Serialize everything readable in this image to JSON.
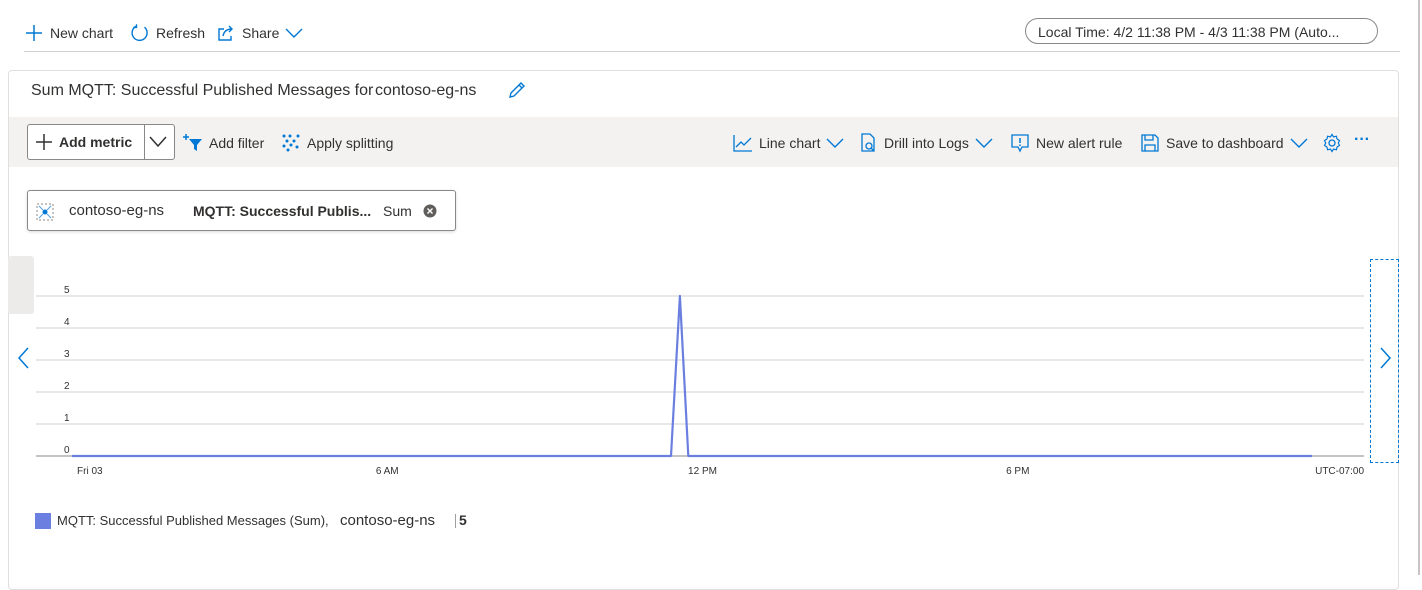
{
  "top_toolbar": {
    "new_chart": "New chart",
    "refresh": "Refresh",
    "share": "Share",
    "time_range": "Local Time: 4/2 11:38 PM - 4/3 11:38 PM (Auto..."
  },
  "card": {
    "title": "Sum MQTT: Successful Published Messages for",
    "resource": "contoso-eg-ns"
  },
  "chart_toolbar": {
    "add_metric": "Add metric",
    "add_filter": "Add filter",
    "apply_splitting": "Apply splitting",
    "line_chart": "Line chart",
    "drill_into_logs": "Drill into Logs",
    "new_alert_rule": "New alert rule",
    "save_to_dashboard": "Save to dashboard",
    "more": "···"
  },
  "metric_pill": {
    "resource": "contoso-eg-ns",
    "metric": "MQTT: Successful Publis...",
    "aggregation": "Sum"
  },
  "chart_data": {
    "type": "line",
    "title": "",
    "xlabel": "",
    "ylabel": "",
    "ylim": [
      0,
      5
    ],
    "y_ticks": [
      "0",
      "1",
      "2",
      "3",
      "4",
      "5"
    ],
    "x_ticks": [
      "Fri 03",
      "6 AM",
      "12 PM",
      "6 PM"
    ],
    "x_range_hours": [
      0,
      24
    ],
    "timezone_label": "UTC-07:00",
    "grid": true,
    "series": [
      {
        "name": "MQTT: Successful Published Messages (Sum), contoso-eg-ns",
        "color": "#6b7fe0",
        "x_hours": [
          0,
          11.4,
          11.57,
          11.73,
          23.6
        ],
        "values": [
          0,
          0,
          5,
          0,
          0
        ]
      }
    ]
  },
  "legend": {
    "metric": "MQTT: Successful Published Messages (Sum),",
    "resource": "contoso-eg-ns",
    "value": "5"
  }
}
